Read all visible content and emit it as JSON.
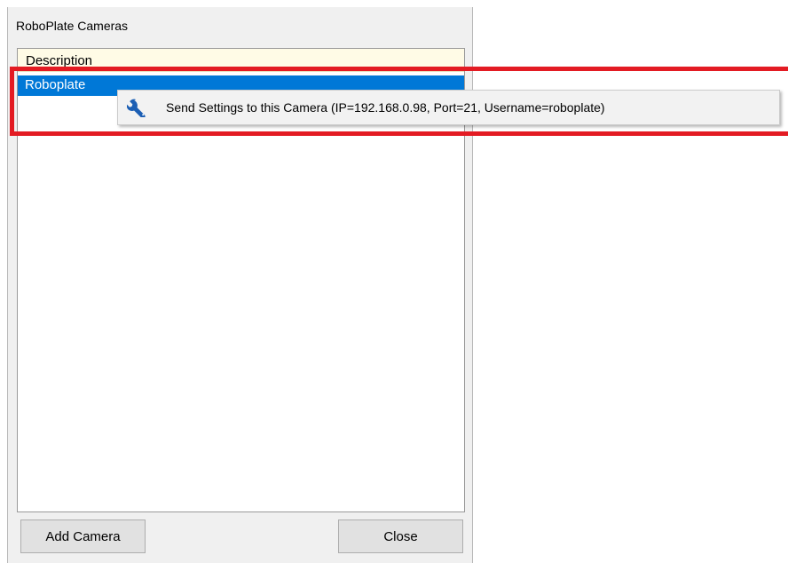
{
  "window": {
    "title": "RoboPlate Cameras"
  },
  "list": {
    "header": "Description",
    "rows": [
      {
        "label": "Roboplate",
        "selected": true
      }
    ]
  },
  "context_menu": {
    "items": [
      {
        "icon": "wrench-icon",
        "label": "Send Settings to this Camera  (IP=192.168.0.98, Port=21, Username=roboplate)"
      }
    ]
  },
  "buttons": {
    "add_camera": "Add Camera",
    "close": "Close"
  },
  "colors": {
    "selection": "#0078d7",
    "header_background": "#fffbe6",
    "highlight": "#e31b23",
    "window_background": "#f0f0f0"
  }
}
